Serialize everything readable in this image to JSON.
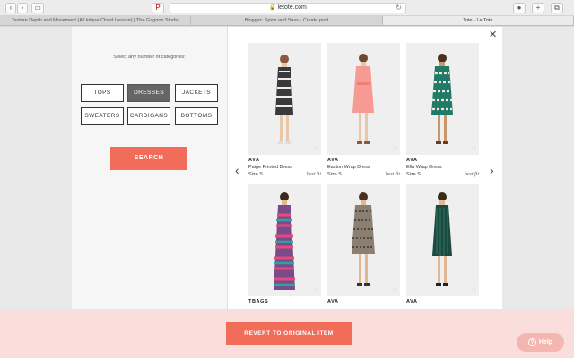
{
  "browser": {
    "url": "letote.com",
    "tabs": [
      {
        "title": "Texture Depth and Movement (A Unique Cloud Lesson) | The Gagnon Studio",
        "active": false
      },
      {
        "title": "Blogger: Spice and Sass - Create post",
        "active": false
      },
      {
        "title": "Tote - Le Tote",
        "active": true
      }
    ],
    "icons": [
      "back-icon",
      "forward-icon",
      "sidebar-icon",
      "pinterest-icon",
      "lock-icon",
      "reload-icon",
      "extension-icon",
      "new-tab-icon",
      "tab-overview-icon"
    ]
  },
  "filter": {
    "instruction": "Select any number of categories:",
    "categories": [
      {
        "label": "TOPS",
        "selected": false
      },
      {
        "label": "DRESSES",
        "selected": true
      },
      {
        "label": "JACKETS",
        "selected": false
      },
      {
        "label": "SWEATERS",
        "selected": false
      },
      {
        "label": "CARDIGANS",
        "selected": false
      },
      {
        "label": "BOTTOMS",
        "selected": false
      }
    ],
    "search_label": "SEARCH"
  },
  "products": [
    {
      "brand": "AVA",
      "name": "Paige Printed Dress",
      "size": "Size S",
      "badge": "best fit"
    },
    {
      "brand": "AVA",
      "name": "Easton Wrap Dress",
      "size": "Size S",
      "badge": "best fit"
    },
    {
      "brand": "AVA",
      "name": "Ella Wrap Dress",
      "size": "Size S",
      "badge": "best fit"
    },
    {
      "brand": "TBAGS",
      "name": "",
      "size": "",
      "badge": ""
    },
    {
      "brand": "AVA",
      "name": "",
      "size": "",
      "badge": ""
    },
    {
      "brand": "AVA",
      "name": "",
      "size": "",
      "badge": ""
    }
  ],
  "actions": {
    "revert_label": "REVERT TO ORIGINAL ITEM",
    "help_label": "Help",
    "close_icon": "close-icon",
    "prev_icon": "chevron-left-icon",
    "next_icon": "chevron-right-icon"
  },
  "colors": {
    "accent": "#f26c5a",
    "selected_category": "#666666",
    "overlay": "#f9dedc"
  }
}
